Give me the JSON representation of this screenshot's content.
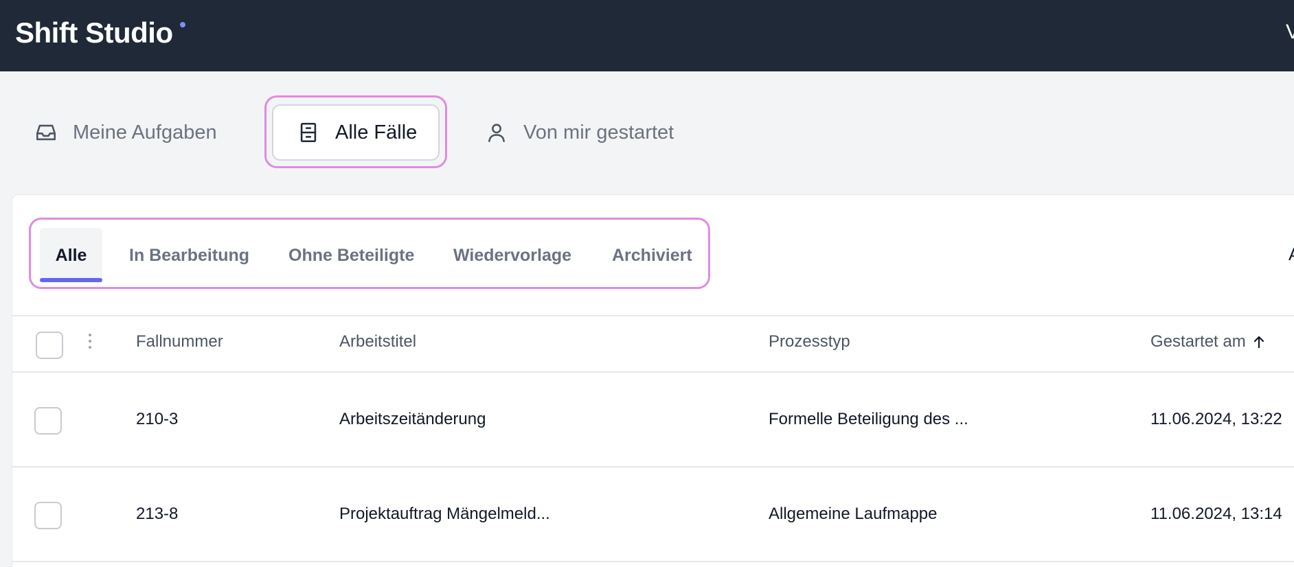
{
  "app": {
    "brand": "Shift Studio",
    "topbar_cut_text": "V"
  },
  "view_tabs": [
    {
      "label": "Meine Aufgaben",
      "icon": "inbox-icon"
    },
    {
      "label": "Alle Fälle",
      "icon": "archive-cabinet-icon",
      "active": true
    },
    {
      "label": "Von mir gestartet",
      "icon": "user-icon"
    }
  ],
  "filter_tabs": [
    {
      "label": "Alle",
      "active": true
    },
    {
      "label": "In Bearbeitung"
    },
    {
      "label": "Ohne Beteiligte"
    },
    {
      "label": "Wiedervorlage"
    },
    {
      "label": "Archiviert"
    }
  ],
  "card_cut_text": "A",
  "table": {
    "columns": [
      "Fallnummer",
      "Arbeitstitel",
      "Prozesstyp",
      "Gestartet am"
    ],
    "sort": {
      "column": "Gestartet am",
      "direction": "ascending"
    },
    "rows": [
      {
        "fallnummer": "210-3",
        "arbeitstitel": "Arbeitszeitänderung",
        "prozesstyp": "Formelle Beteiligung des ...",
        "gestartet": "11.06.2024, 13:22"
      },
      {
        "fallnummer": "213-8",
        "arbeitstitel": "Projektauftrag Mängelmeld...",
        "prozesstyp": "Allgemeine Laufmappe",
        "gestartet": "11.06.2024, 13:14"
      }
    ]
  },
  "colors": {
    "topbar": "#1f2937",
    "accent": "#6366f1",
    "highlight": "#e08be0"
  }
}
